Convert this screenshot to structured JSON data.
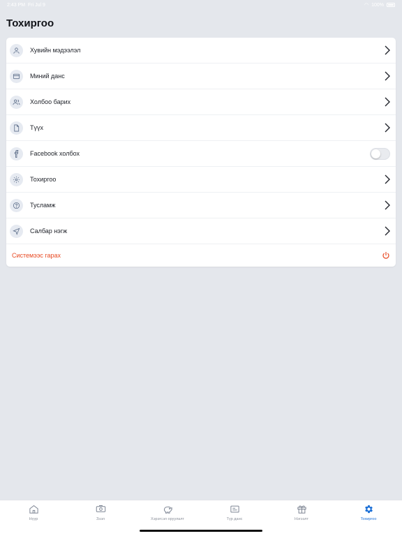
{
  "status": {
    "time": "2:43 PM",
    "date": "Fri Jul 9",
    "battery": "100%"
  },
  "page": {
    "title": "Тохиргоо"
  },
  "menu": {
    "items": [
      {
        "label": "Хувийн мэдээлэл",
        "icon": "user-icon"
      },
      {
        "label": "Миний данс",
        "icon": "card-icon"
      },
      {
        "label": "Холбоо барих",
        "icon": "users-icon"
      },
      {
        "label": "Түүх",
        "icon": "file-icon"
      },
      {
        "label": "Facebook холбох",
        "icon": "facebook-icon",
        "toggle": false
      },
      {
        "label": "Тохиргоо",
        "icon": "gear-icon"
      },
      {
        "label": "Тусламж",
        "icon": "help-icon"
      },
      {
        "label": "Салбар нэгж",
        "icon": "navigation-icon"
      }
    ],
    "logout": {
      "label": "Системээс гарах",
      "icon": "power-icon",
      "color": "#e84a23"
    }
  },
  "tabs": [
    {
      "label": "Нүүр",
      "icon": "home-icon"
    },
    {
      "label": "Зээл",
      "icon": "loan-icon"
    },
    {
      "label": "Хэрэгсэл оруулалт",
      "icon": "piggy-bank-icon"
    },
    {
      "label": "Түр данс",
      "icon": "account-icon"
    },
    {
      "label": "Нэгээлт",
      "icon": "gift-icon"
    },
    {
      "label": "Тохиргоо",
      "icon": "gear-icon",
      "active": true
    }
  ],
  "colors": {
    "accent": "#1b6fd6",
    "danger": "#e84a23",
    "background": "#e4e7ec"
  }
}
